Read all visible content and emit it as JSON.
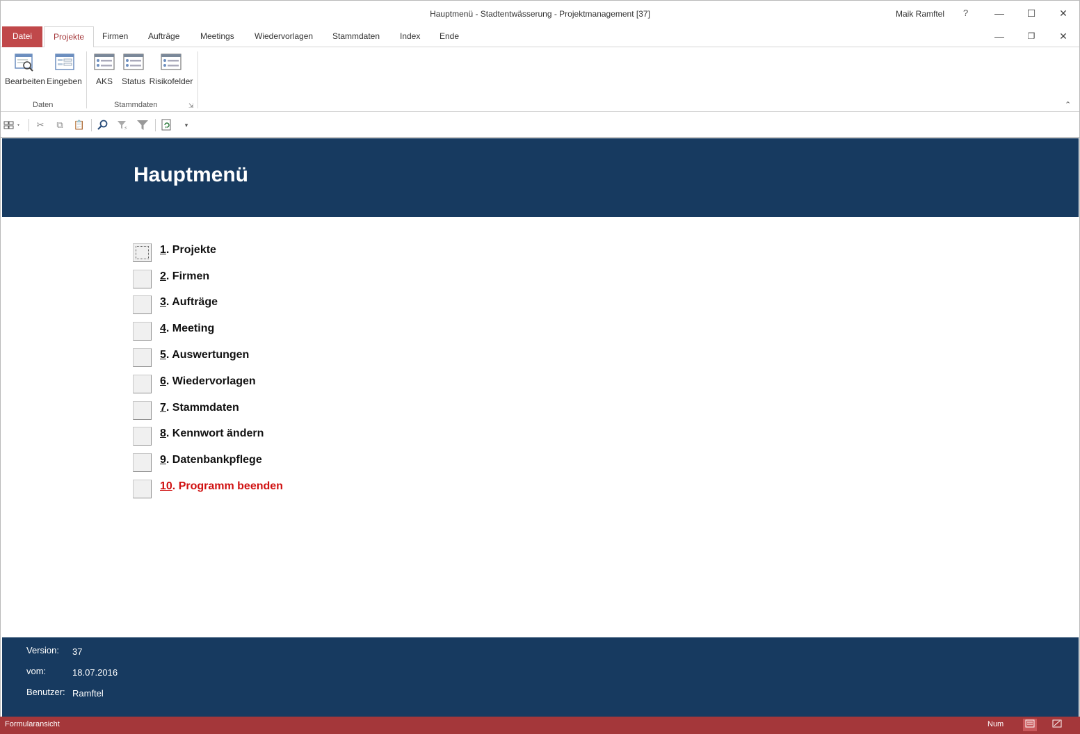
{
  "window": {
    "title": "Hauptmenü - Stadtentwässerung - Projektmanagement [37]",
    "user": "Maik Ramftel",
    "help": "?"
  },
  "ribbon": {
    "tabs": [
      {
        "label": "Datei"
      },
      {
        "label": "Projekte"
      },
      {
        "label": "Firmen"
      },
      {
        "label": "Aufträge"
      },
      {
        "label": "Meetings"
      },
      {
        "label": "Wiedervorlagen"
      },
      {
        "label": "Stammdaten"
      },
      {
        "label": "Index"
      },
      {
        "label": "Ende"
      }
    ],
    "groups": [
      {
        "label": "Daten",
        "buttons": [
          {
            "label": "Bearbeiten"
          },
          {
            "label": "Eingeben"
          }
        ]
      },
      {
        "label": "Stammdaten",
        "buttons": [
          {
            "label": "AKS"
          },
          {
            "label": "Status"
          },
          {
            "label": "Risikofelder"
          }
        ]
      }
    ]
  },
  "form": {
    "title": "Hauptmenü",
    "menu": [
      {
        "num": "1",
        "text": ". Projekte"
      },
      {
        "num": "2",
        "text": ". Firmen"
      },
      {
        "num": "3",
        "text": ". Aufträge"
      },
      {
        "num": "4",
        "text": ". Meeting"
      },
      {
        "num": "5",
        "text": ". Auswertungen"
      },
      {
        "num": "6",
        "text": ". Wiedervorlagen"
      },
      {
        "num": "7",
        "text": ". Stammdaten"
      },
      {
        "num": "8",
        "text": ". Kennwort ändern"
      },
      {
        "num": "9",
        "text": ". Datenbankpflege"
      },
      {
        "num": "10",
        "text": ". Programm beenden"
      }
    ],
    "footer": {
      "version_label": "Version:",
      "version_value": "37",
      "date_label": "vom:",
      "date_value": "18.07.2016",
      "user_label": "Benutzer:",
      "user_value": "Ramftel"
    }
  },
  "status": {
    "view": "Formularansicht",
    "num": "Num"
  },
  "colors": {
    "band": "#173a60",
    "accent": "#a4373a",
    "exit_red": "#d01010"
  }
}
